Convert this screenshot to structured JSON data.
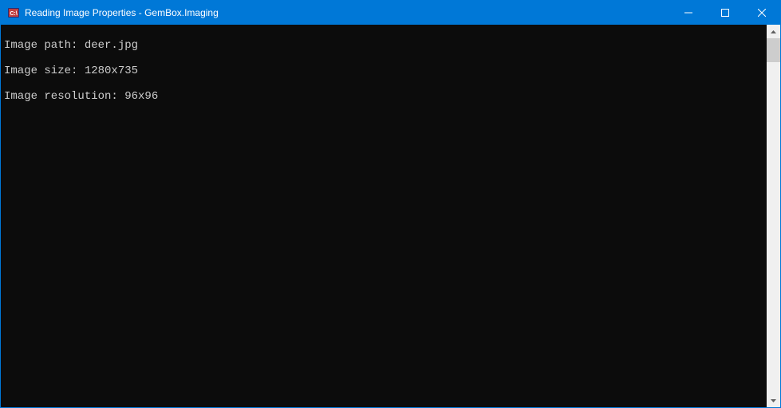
{
  "window": {
    "title": "Reading Image Properties - GemBox.Imaging"
  },
  "console": {
    "lines": [
      "Image path: deer.jpg",
      "Image size: 1280x735",
      "Image resolution: 96x96"
    ]
  }
}
